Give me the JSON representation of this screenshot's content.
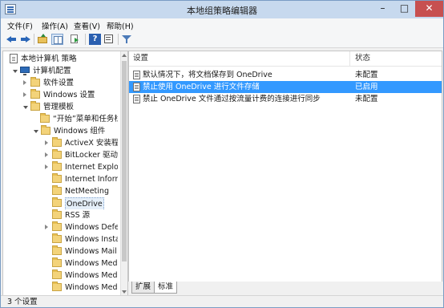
{
  "window": {
    "title": "本地组策略编辑器"
  },
  "menu": {
    "items": [
      "文件(F)",
      "操作(A)",
      "查看(V)",
      "帮助(H)"
    ]
  },
  "tree": {
    "items": [
      {
        "label": "本地计算机 策略"
      },
      {
        "label": "计算机配置"
      },
      {
        "label": "软件设置"
      },
      {
        "label": "Windows 设置"
      },
      {
        "label": "管理模板"
      },
      {
        "label": "“开始”菜单和任务栏"
      },
      {
        "label": "Windows 组件"
      },
      {
        "label": "ActiveX 安装程序服务"
      },
      {
        "label": "BitLocker 驱动器加密"
      },
      {
        "label": "Internet Explorer"
      },
      {
        "label": "Internet Information Services"
      },
      {
        "label": "NetMeeting"
      },
      {
        "label": "OneDrive"
      },
      {
        "label": "RSS 源"
      },
      {
        "label": "Windows Defender"
      },
      {
        "label": "Windows Installer"
      },
      {
        "label": "Windows Mail"
      },
      {
        "label": "Windows Media Center"
      },
      {
        "label": "Windows Media Player"
      },
      {
        "label": "Windows Media 数字权限管理"
      }
    ]
  },
  "list": {
    "columns": {
      "setting": "设置",
      "state": "状态"
    },
    "rows": [
      {
        "name": "默认情况下，将文档保存到 OneDrive",
        "state": "未配置"
      },
      {
        "name": "禁止使用 OneDrive 进行文件存储",
        "state": "已启用"
      },
      {
        "name": "禁止 OneDrive 文件通过按流量计费的连接进行同步",
        "state": "未配置"
      }
    ]
  },
  "tabs": {
    "extended": "扩展",
    "standard": "标准"
  },
  "status": {
    "text": "3 个设置"
  },
  "colors": {
    "selection": "#3399ff",
    "close": "#c75050",
    "title": "#c7d9ee"
  }
}
